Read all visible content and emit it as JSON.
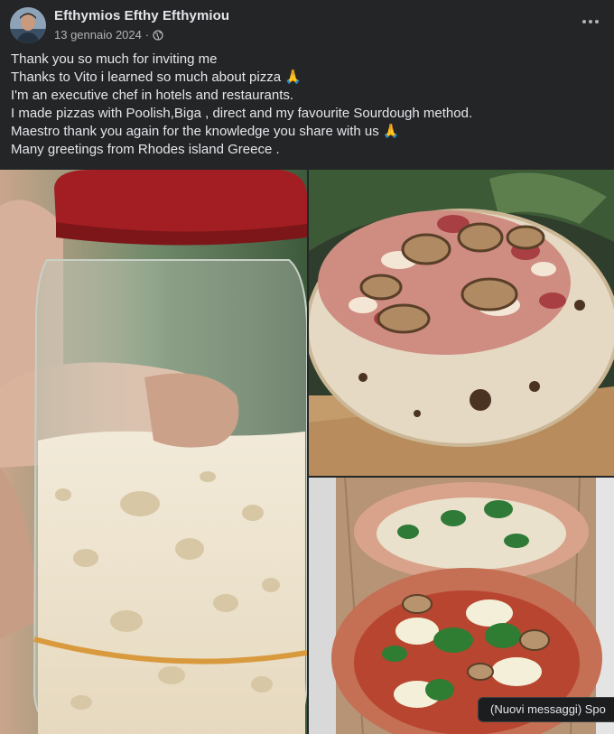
{
  "post": {
    "author": "Efthymios Efthy Efthymiou",
    "date": "13 gennaio 2024",
    "separator": "·",
    "privacy_icon": "globe-icon",
    "more_icon": "more-options-icon",
    "lines": [
      "Thank you so much for inviting me",
      "Thanks to Vito i learned so much about pizza 🙏",
      "I'm an executive chef in hotels and restaurants.",
      "I made pizzas with Poolish,Biga , direct and my favourite Sourdough method.",
      "Maestro thank you again for the knowledge you share with us 🙏",
      "Many greetings from Rhodes island Greece ."
    ]
  },
  "photos": [
    {
      "subject": "sourdough-starter-jar"
    },
    {
      "subject": "mushroom-pizza"
    },
    {
      "subject": "basil-pizzas-on-board"
    }
  ],
  "toast": {
    "label": "(Nuovi messaggi) Spo"
  },
  "colors": {
    "background": "#242526",
    "text": "#e4e6eb",
    "secondary_text": "#b0b3b8",
    "jar_lid": "#a31e22"
  }
}
